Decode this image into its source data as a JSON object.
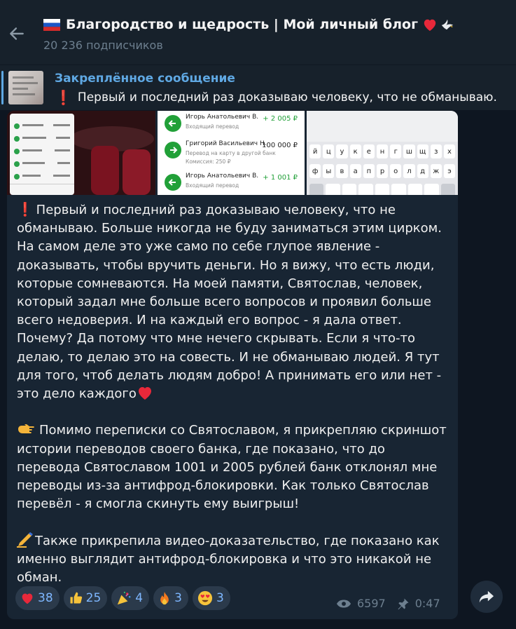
{
  "header": {
    "title": "Благородство и щедрость | Мой личный блог",
    "subscribers": "20 236 подписчиков"
  },
  "pinned": {
    "label": "Закреплённое сообщение",
    "text": "Первый и последний раз доказываю человеку, что не обманываю."
  },
  "photos": {
    "bank_rows": [
      {
        "name": "Игорь Анатольевич В.",
        "sub": "Входящий перевод",
        "amount": "+ 2 005 ₽",
        "green": true
      },
      {
        "name": "Григорий Васильевич Н.",
        "sub": "Перевод на карту в другой банк",
        "amount": "100 000 ₽",
        "green": false,
        "extra": "Комиссия: 250 ₽"
      },
      {
        "name": "Игорь Анатольевич В.",
        "sub": "Входящий перевод",
        "amount": "+ 1 001 ₽",
        "green": true
      }
    ],
    "keyboard_rows": [
      [
        "й",
        "ц",
        "у",
        "к",
        "е",
        "н",
        "г",
        "ш",
        "щ",
        "з",
        "х"
      ],
      [
        "ф",
        "ы",
        "в",
        "а",
        "п",
        "р",
        "о",
        "л",
        "д",
        "ж",
        "э"
      ]
    ]
  },
  "post": {
    "text": "Первый и последний раз доказываю человеку, что не обманываю. Больше никогда не буду заниматься этим цирком. На самом деле это уже само по себе глупое явление - доказывать, чтобы вручить деньги. Но я вижу, что есть люди, которые сомневаются. На моей памяти, Святослав, человек, который задал мне больше всего вопросов и проявил больше всего недоверия. И на каждый его вопрос - я дала ответ. Почему? Да потому что мне нечего скрывать. Если я что-то делаю, то делаю это на совесть. И не обманываю людей. Я тут для того, чтоб делать людям добро! А принимать его или нет - это дело каждого",
    "para2": "Помимо переписки со Святославом, я прикрепляю скриншот истории переводов своего банка, где показано, что до перевода Святославом 1001 и 2005 рублей банк отклонял мне переводы из-за антифрод-блокировки. Как только Святослав перевёл - я смогла скинуть ему выигрыш!",
    "para3": "Также прикрепила видео-доказательство, где показано как именно выглядит антифрод-блокировка и что это никакой не обман."
  },
  "reactions": [
    {
      "icon": "heart-icon",
      "count": "38"
    },
    {
      "icon": "thumbs-up-icon",
      "count": "25"
    },
    {
      "icon": "party-popper-icon",
      "count": "4"
    },
    {
      "icon": "fire-icon",
      "count": "3"
    },
    {
      "icon": "heart-eyes-icon",
      "count": "3"
    }
  ],
  "meta": {
    "views": "6597",
    "time": "0:47"
  },
  "colors": {
    "accent": "#5fa8e3",
    "bubble": "#182533",
    "background": "#0e1621",
    "header": "#17212b"
  }
}
